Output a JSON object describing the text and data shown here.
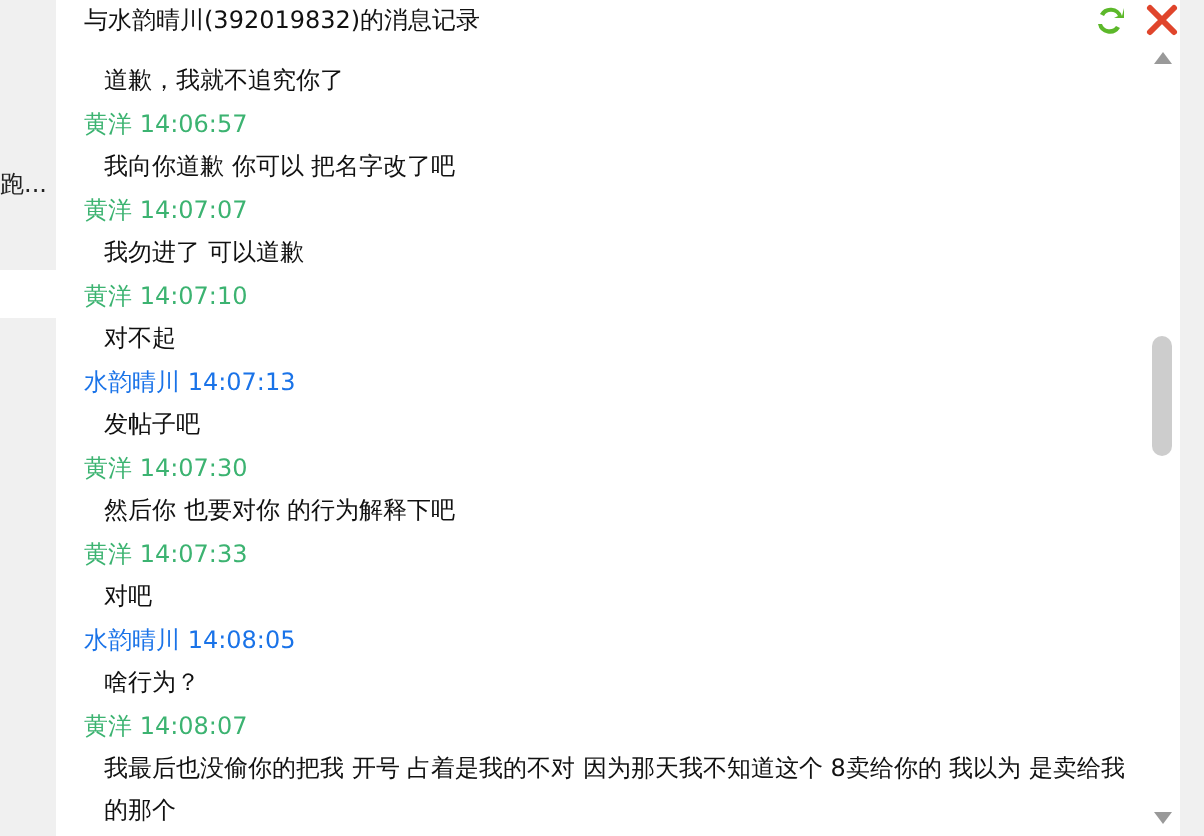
{
  "window": {
    "title": "与水韵晴川(392019832)的消息记录"
  },
  "left_strip": {
    "label": "跑..."
  },
  "messages": [
    {
      "text": "道歉，我就不追究你了"
    },
    {
      "sender": "黄洋",
      "time": "14:06:57",
      "color": "#3cb371",
      "text": "我向你道歉  你可以 把名字改了吧"
    },
    {
      "sender": "黄洋",
      "time": "14:07:07",
      "color": "#3cb371",
      "text": "我勿进了 可以道歉"
    },
    {
      "sender": "黄洋",
      "time": "14:07:10",
      "color": "#3cb371",
      "text": "对不起"
    },
    {
      "sender": "水韵晴川",
      "time": "14:07:13",
      "color": "#1a73e8",
      "text": "发帖子吧"
    },
    {
      "sender": "黄洋",
      "time": "14:07:30",
      "color": "#3cb371",
      "text": "然后你 也要对你 的行为解释下吧"
    },
    {
      "sender": "黄洋",
      "time": "14:07:33",
      "color": "#3cb371",
      "text": "对吧"
    },
    {
      "sender": "水韵晴川",
      "time": "14:08:05",
      "color": "#1a73e8",
      "text": "啥行为？"
    },
    {
      "sender": "黄洋",
      "time": "14:08:07",
      "color": "#3cb371",
      "text": "我最后也没偷你的把我 开号 占着是我的不对 因为那天我不知道这个 8卖给你的 我以为 是卖给我的那个"
    }
  ]
}
